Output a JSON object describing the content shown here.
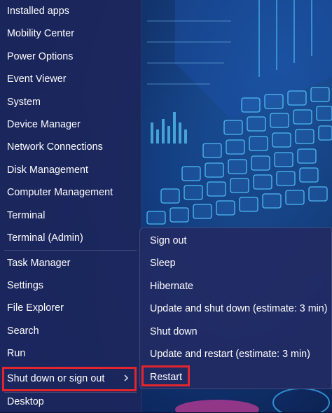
{
  "menu": {
    "items": [
      {
        "label": "Installed apps"
      },
      {
        "label": "Mobility Center"
      },
      {
        "label": "Power Options"
      },
      {
        "label": "Event Viewer"
      },
      {
        "label": "System"
      },
      {
        "label": "Device Manager"
      },
      {
        "label": "Network Connections"
      },
      {
        "label": "Disk Management"
      },
      {
        "label": "Computer Management"
      },
      {
        "label": "Terminal"
      },
      {
        "label": "Terminal (Admin)"
      },
      {
        "label": "Task Manager"
      },
      {
        "label": "Settings"
      },
      {
        "label": "File Explorer"
      },
      {
        "label": "Search"
      },
      {
        "label": "Run"
      },
      {
        "label": "Shut down or sign out"
      },
      {
        "label": "Desktop"
      }
    ]
  },
  "submenu": {
    "items": [
      {
        "label": "Sign out"
      },
      {
        "label": "Sleep"
      },
      {
        "label": "Hibernate"
      },
      {
        "label": "Update and shut down (estimate: 3 min)"
      },
      {
        "label": "Shut down"
      },
      {
        "label": "Update and restart (estimate: 3 min)"
      },
      {
        "label": "Restart"
      }
    ]
  },
  "colors": {
    "highlight_border": "#e3262d",
    "menu_background": "#1c275c",
    "text": "#ffffff"
  },
  "icons": {
    "submenu_arrow": "chevron-right-icon"
  }
}
